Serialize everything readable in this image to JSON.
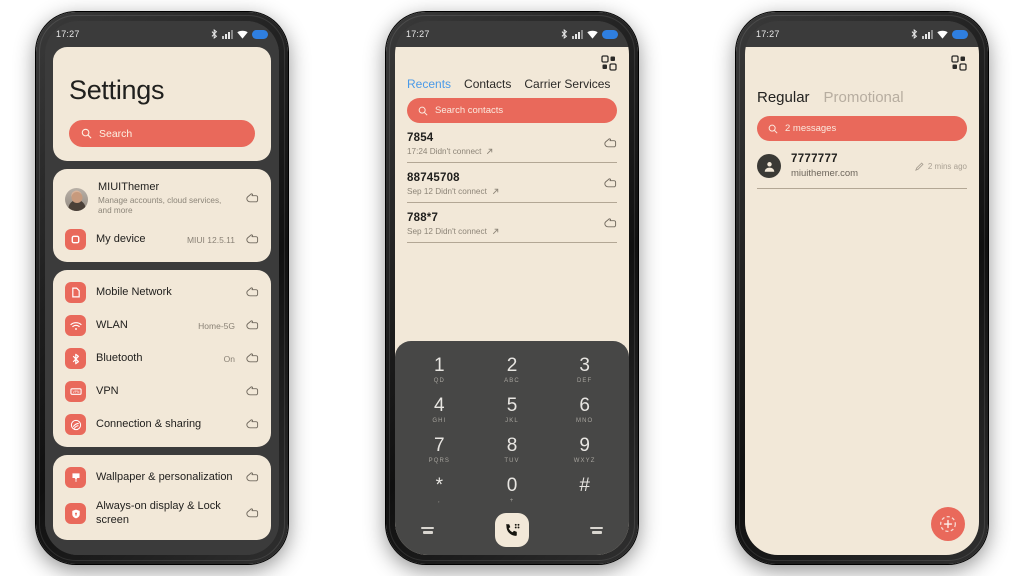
{
  "status_bar": {
    "time": "17:27",
    "icons": [
      "bluetooth-icon",
      "signal-icon",
      "wifi-icon",
      "battery-icon"
    ]
  },
  "theme": {
    "accent": "#e9695b",
    "card_bg": "#f2e8d8",
    "frame_bg": "#3b3b3b",
    "active_tab": "#4a9ae8"
  },
  "phone1": {
    "title": "Settings",
    "search": {
      "placeholder": "Search",
      "icon": "search-icon"
    },
    "group_account": [
      {
        "icon": "avatar",
        "label": "MIUIThemer",
        "sub": "Manage accounts, cloud services, and more",
        "value": ""
      },
      {
        "icon": "device-icon",
        "label": "My device",
        "sub": "",
        "value": "MIUI 12.5.11"
      }
    ],
    "group_network": [
      {
        "icon": "sim-icon",
        "label": "Mobile Network",
        "value": ""
      },
      {
        "icon": "wifi-icon",
        "label": "WLAN",
        "value": "Home-5G"
      },
      {
        "icon": "bluetooth-icon",
        "label": "Bluetooth",
        "value": "On"
      },
      {
        "icon": "vpn-icon",
        "label": "VPN",
        "value": ""
      },
      {
        "icon": "sharing-icon",
        "label": "Connection & sharing",
        "value": ""
      }
    ],
    "group_display": [
      {
        "icon": "wallpaper-icon",
        "label": "Wallpaper & personalization",
        "value": ""
      },
      {
        "icon": "lock-icon",
        "label": "Always-on display & Lock screen",
        "value": ""
      }
    ]
  },
  "phone2": {
    "grid_icon": "apps-grid-icon",
    "tabs": [
      {
        "label": "Recents",
        "active": true
      },
      {
        "label": "Contacts",
        "active": false
      },
      {
        "label": "Carrier Services",
        "active": false
      }
    ],
    "search": {
      "placeholder": "Search contacts",
      "icon": "search-icon"
    },
    "calls": [
      {
        "number": "7854",
        "meta": "17:24 Didn't connect"
      },
      {
        "number": "88745708",
        "meta": "Sep 12 Didn't connect"
      },
      {
        "number": "788*7",
        "meta": "Sep 12 Didn't connect"
      }
    ],
    "keypad": [
      {
        "digit": "1",
        "letters": "QD"
      },
      {
        "digit": "2",
        "letters": "ABC"
      },
      {
        "digit": "3",
        "letters": "DEF"
      },
      {
        "digit": "4",
        "letters": "GHI"
      },
      {
        "digit": "5",
        "letters": "JKL"
      },
      {
        "digit": "6",
        "letters": "MNO"
      },
      {
        "digit": "7",
        "letters": "PQRS"
      },
      {
        "digit": "8",
        "letters": "TUV"
      },
      {
        "digit": "9",
        "letters": "WXYZ"
      },
      {
        "digit": "*",
        "letters": ","
      },
      {
        "digit": "0",
        "letters": "+"
      },
      {
        "digit": "#",
        "letters": ""
      }
    ],
    "call_button_icon": "phone-dialpad-icon"
  },
  "phone3": {
    "grid_icon": "apps-grid-icon",
    "tabs": [
      {
        "label": "Regular",
        "active": true
      },
      {
        "label": "Promotional",
        "active": false
      }
    ],
    "search": {
      "placeholder": "2 messages",
      "icon": "search-icon"
    },
    "messages": [
      {
        "number": "7777777",
        "preview": "miuithemer.com",
        "time": "2 mins ago",
        "icon": "pencil-icon"
      }
    ],
    "fab": {
      "icon": "plus-icon"
    }
  }
}
